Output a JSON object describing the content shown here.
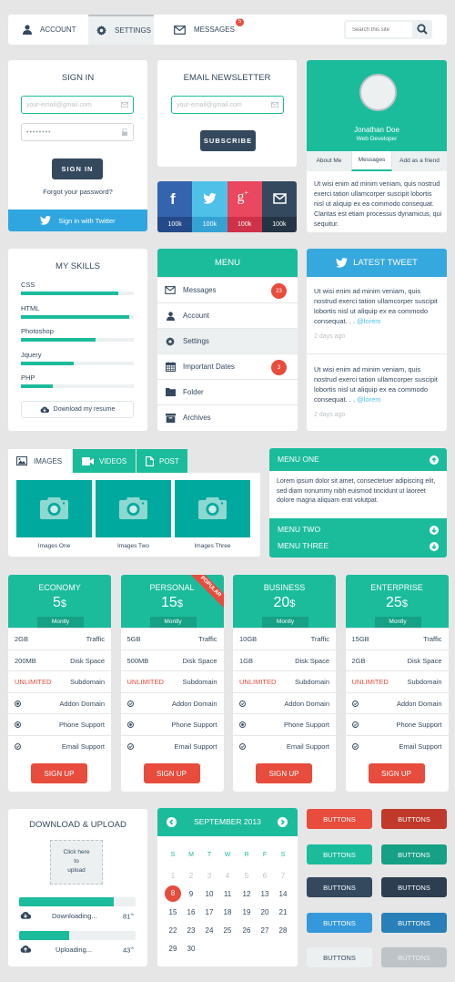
{
  "nav": {
    "items": [
      {
        "label": "Account",
        "icon": "user-icon"
      },
      {
        "label": "Settings",
        "icon": "gear-icon"
      },
      {
        "label": "Messages",
        "icon": "envelope-icon",
        "badge": "5"
      }
    ],
    "search_placeholder": "Search this site"
  },
  "signin": {
    "title": "Sign In",
    "email_placeholder": "your-email@gmail.com",
    "password_value": "••••••••",
    "button": "Sign In",
    "forgot": "Forgot your password?",
    "twitter": "Sign in with Twitter"
  },
  "newsletter": {
    "title": "Email Newsletter",
    "email_placeholder": "your-email@gmail.com",
    "button": "Subscribe"
  },
  "social": [
    {
      "network": "facebook",
      "count": "100k",
      "color": "#3b5998"
    },
    {
      "network": "twitter",
      "count": "100k",
      "color": "#4fc1e9"
    },
    {
      "network": "google-plus",
      "count": "100k",
      "color": "#e9485e"
    },
    {
      "network": "email",
      "count": "100k",
      "color": "#34495e"
    }
  ],
  "profile": {
    "name": "Jonathan Doe",
    "role": "Web Developer",
    "tabs": [
      "About Me",
      "Messages",
      "Add as a friend"
    ],
    "active_tab": "Messages",
    "text": "Ut wisi enim ad minim veniam, quis nostrud exerci tation ullamcorper suscipit lobortis nisl ut aliquip ex ea commodo consequat. Claritas est etiam processus dynamicus, qui sequitur."
  },
  "skills": {
    "title": "My Skills",
    "items": [
      {
        "label": "CSS",
        "percent": 86
      },
      {
        "label": "HTML",
        "percent": 96
      },
      {
        "label": "Photoshop",
        "percent": 66
      },
      {
        "label": "Jquery",
        "percent": 47
      },
      {
        "label": "PHP",
        "percent": 28
      }
    ],
    "download": "Download my resume"
  },
  "menu": {
    "title": "Menu",
    "items": [
      {
        "label": "Messages",
        "icon": "envelope-icon",
        "badge": "23"
      },
      {
        "label": "Account",
        "icon": "user-icon"
      },
      {
        "label": "Settings",
        "icon": "gear-icon",
        "active": true
      },
      {
        "label": "Important Dates",
        "icon": "calendar-icon",
        "badge": "3"
      },
      {
        "label": "Folder",
        "icon": "folder-icon"
      },
      {
        "label": "Archives",
        "icon": "archive-icon"
      }
    ]
  },
  "tweets": {
    "title": "Latest Tweet",
    "items": [
      {
        "text": "Ut wisi enim ad minim veniam, quis nostrud exerci tation ullamcorper suscipit lobortis nisl ut aliquip ex ea commodo consequat. . .",
        "handle": "@lorem",
        "time": "2 days ago"
      },
      {
        "text": "Ut wisi enim ad minim veniam, quis nostrud exerci tation ullamcorper suscipit lobortis nisl ut aliquip ex ea commodo consequat. . .",
        "handle": "@lorem",
        "time": "2 days ago"
      }
    ]
  },
  "media": {
    "tabs": [
      "Images",
      "Videos",
      "Post"
    ],
    "images": [
      "Images One",
      "Images Two",
      "Images Three"
    ]
  },
  "accordion": {
    "items": [
      {
        "label": "Menu One",
        "open": true,
        "text": "Lorem ipsum dolor sit amet, consectetuer adipiscing elit, sed diam nonummy nibh euismod tincidunt ut laoreet dolore magna aliquam erat volutpat."
      },
      {
        "label": "Menu Two",
        "open": false
      },
      {
        "label": "Menu Three",
        "open": false
      }
    ]
  },
  "pricing": {
    "period": "Montly",
    "popular_label": "Popular",
    "signup": "Sign Up",
    "plans": [
      {
        "name": "Economy",
        "price": "5",
        "currency": "$",
        "traffic": "2GB",
        "disk": "200MB",
        "subdomain": "UNLIMITED"
      },
      {
        "name": "Personal",
        "price": "15",
        "currency": "$",
        "traffic": "5GB",
        "disk": "500MB",
        "subdomain": "UNLIMITED",
        "popular": true
      },
      {
        "name": "Business",
        "price": "20",
        "currency": "$",
        "traffic": "10GB",
        "disk": "1GB",
        "subdomain": "UNLIMITED"
      },
      {
        "name": "Enterprise",
        "price": "25",
        "currency": "$",
        "traffic": "15GB",
        "disk": "2GB",
        "subdomain": "UNLIMITED"
      }
    ],
    "labels": {
      "traffic": "Traffic",
      "disk": "Disk Space",
      "subdomain": "Subdomain",
      "addon": "Addon Domain",
      "phone": "Phone Support",
      "email": "Email Support"
    }
  },
  "transfer": {
    "title": "Download & Upload",
    "dropzone": [
      "Click here",
      "to",
      "upload"
    ],
    "download": {
      "label": "Downloading...",
      "percent": 81,
      "display": "81"
    },
    "upload": {
      "label": "Uploading...",
      "percent": 43,
      "display": "43"
    },
    "pct_sign": "%"
  },
  "calendar": {
    "title": "September 2013",
    "weekdays": [
      "S",
      "M",
      "T",
      "W",
      "R",
      "F",
      "S"
    ],
    "prev_month_days": [
      "1",
      "2",
      "3",
      "4",
      "5",
      "6",
      "7"
    ],
    "days": [
      "8",
      "9",
      "10",
      "11",
      "12",
      "13",
      "14",
      "15",
      "16",
      "17",
      "18",
      "19",
      "20",
      "21",
      "22",
      "23",
      "24",
      "25",
      "26",
      "27",
      "28",
      "29",
      "30"
    ],
    "selected": "8"
  },
  "buttons": {
    "label": "Buttons",
    "colors": [
      [
        "#e74c3c",
        "#c0392b"
      ],
      [
        "#1abc9c",
        "#16a085"
      ],
      [
        "#34495e",
        "#2c3e50"
      ],
      [
        "#3498db",
        "#2980b9"
      ],
      [
        "#ecf0f1",
        "#bdc3c7"
      ]
    ]
  }
}
